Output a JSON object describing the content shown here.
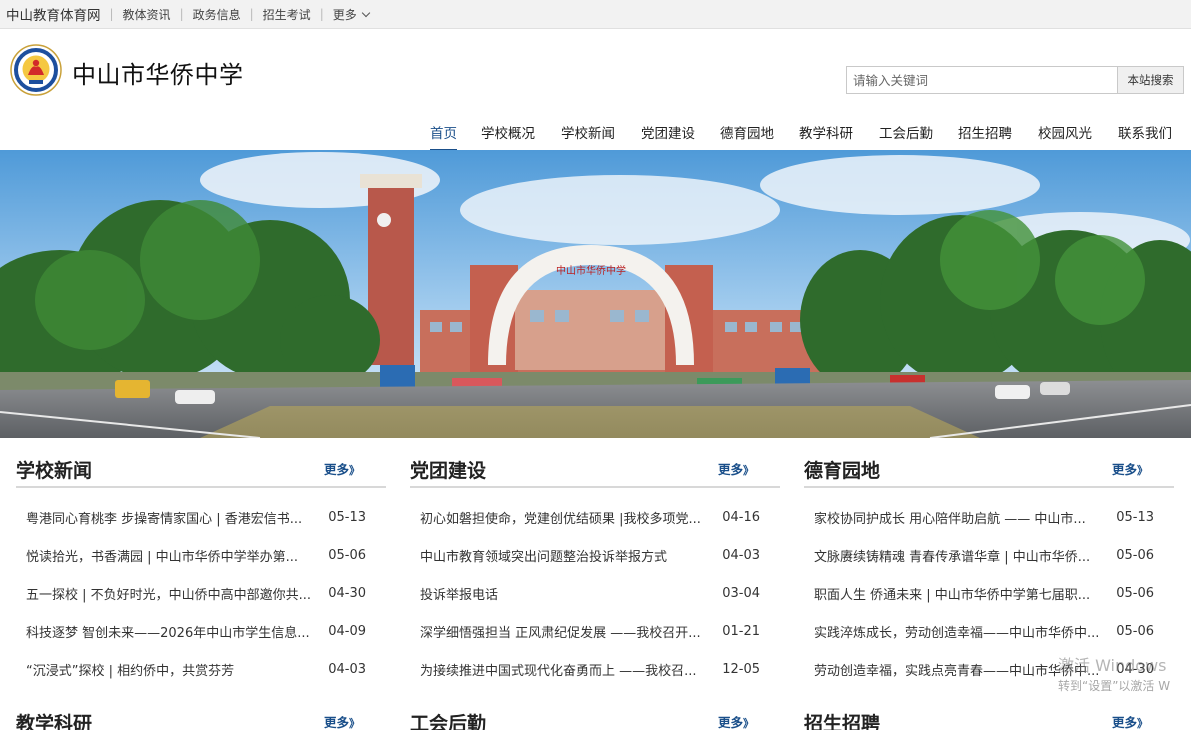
{
  "topbar": {
    "site_name": "中山教育体育网",
    "links": [
      "教体资讯",
      "政务信息",
      "招生考试"
    ],
    "more_label": "更多"
  },
  "header": {
    "school_name": "中山市华侨中学",
    "search": {
      "placeholder": "请输入关键词",
      "button": "本站搜索"
    }
  },
  "nav": {
    "items": [
      "首页",
      "学校概况",
      "学校新闻",
      "党团建设",
      "德育园地",
      "教学科研",
      "工会后勤",
      "招生招聘",
      "校园风光",
      "联系我们"
    ],
    "active": "首页"
  },
  "banner": {
    "gate_text": "中山市华侨中学"
  },
  "sections": [
    {
      "title": "学校新闻",
      "more": "更多",
      "items": [
        {
          "title": "粤港同心育桃李 步操寄情家国心 | 香港宏信书...",
          "date": "05-13"
        },
        {
          "title": "悦读拾光，书香满园 | 中山市华侨中学举办第...",
          "date": "05-06"
        },
        {
          "title": "五一探校 | 不负好时光，中山侨中高中部邀你共...",
          "date": "04-30"
        },
        {
          "title": "科技逐梦 智创未来——2026年中山市学生信息...",
          "date": "04-09"
        },
        {
          "title": "“沉浸式”探校 | 相约侨中，共赏芬芳",
          "date": "04-03"
        }
      ]
    },
    {
      "title": "党团建设",
      "more": "更多",
      "items": [
        {
          "title": "初心如磐担使命，党建创优结硕果 |我校多项党...",
          "date": "04-16"
        },
        {
          "title": "中山市教育领域突出问题整治投诉举报方式",
          "date": "04-03"
        },
        {
          "title": "投诉举报电话",
          "date": "03-04"
        },
        {
          "title": "深学细悟强担当 正风肃纪促发展 ——我校召开...",
          "date": "01-21"
        },
        {
          "title": "为接续推进中国式现代化奋勇而上 ——我校召...",
          "date": "12-05"
        }
      ]
    },
    {
      "title": "德育园地",
      "more": "更多",
      "items": [
        {
          "title": "家校协同护成长 用心陪伴助启航 —— 中山市...",
          "date": "05-13"
        },
        {
          "title": "文脉赓续铸精魂 青春传承谱华章 | 中山市华侨...",
          "date": "05-06"
        },
        {
          "title": "职面人生 侨通未来 | 中山市华侨中学第七届职...",
          "date": "05-06"
        },
        {
          "title": "实践淬炼成长，劳动创造幸福——中山市华侨中...",
          "date": "05-06"
        },
        {
          "title": "劳动创造幸福，实践点亮青春——中山市华侨中...",
          "date": "04-30"
        }
      ]
    }
  ],
  "sections2": [
    {
      "title": "教学科研",
      "more": "更多"
    },
    {
      "title": "工会后勤",
      "more": "更多"
    },
    {
      "title": "招生招聘",
      "more": "更多"
    }
  ],
  "watermark": {
    "line1": "激活 Windows",
    "line2": "转到“设置”以激活 W"
  },
  "colors": {
    "accent": "#1a4f8a",
    "topbar_bg": "#f2f2f2"
  }
}
